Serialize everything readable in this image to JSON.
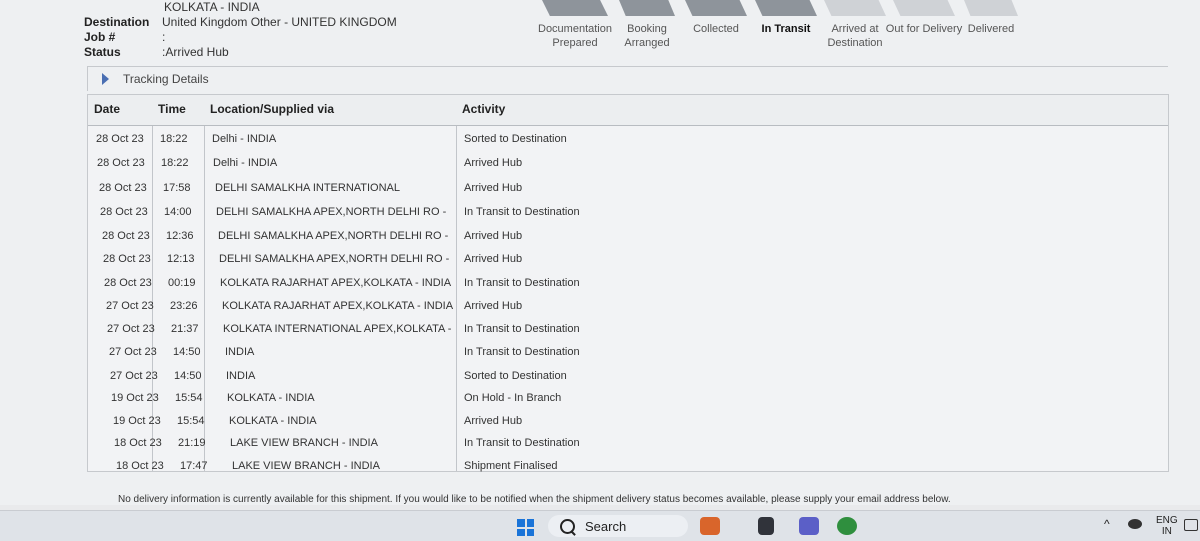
{
  "header": {
    "origin_value": "KOLKATA - INDIA",
    "destination_label": "Destination",
    "destination_value": "United Kingdom Other - UNITED KINGDOM",
    "job_label": "Job #",
    "job_value": ":",
    "status_label": "Status",
    "status_value": ":Arrived Hub"
  },
  "steps": [
    {
      "label": "Documentation Prepared",
      "state": "done"
    },
    {
      "label": "Booking Arranged",
      "state": "done"
    },
    {
      "label": "Collected",
      "state": "done"
    },
    {
      "label": "In Transit",
      "state": "current"
    },
    {
      "label": "Arrived at Destination",
      "state": "future"
    },
    {
      "label": "Out for Delivery",
      "state": "future"
    },
    {
      "label": "Delivered",
      "state": "future"
    }
  ],
  "tracking": {
    "section_title": "Tracking Details",
    "columns": {
      "date": "Date",
      "time": "Time",
      "location": "Location/Supplied via",
      "activity": "Activity"
    },
    "rows": [
      {
        "date": "28 Oct 23",
        "time": "18:22",
        "location": "Delhi - INDIA",
        "activity": "Sorted to Destination"
      },
      {
        "date": "28 Oct 23",
        "time": "18:22",
        "location": "Delhi - INDIA",
        "activity": "Arrived Hub"
      },
      {
        "date": "28 Oct 23",
        "time": "17:58",
        "location": "DELHI SAMALKHA INTERNATIONAL",
        "activity": "Arrived Hub"
      },
      {
        "date": "28 Oct 23",
        "time": "14:00",
        "location": "DELHI SAMALKHA APEX,NORTH DELHI RO -",
        "activity": "In Transit to Destination"
      },
      {
        "date": "28 Oct 23",
        "time": "12:36",
        "location": "DELHI SAMALKHA APEX,NORTH DELHI RO -",
        "activity": "Arrived Hub"
      },
      {
        "date": "28 Oct 23",
        "time": "12:13",
        "location": "DELHI SAMALKHA APEX,NORTH DELHI RO -",
        "activity": "Arrived Hub"
      },
      {
        "date": "28 Oct 23",
        "time": "00:19",
        "location": "KOLKATA RAJARHAT APEX,KOLKATA - INDIA",
        "activity": "In Transit to Destination"
      },
      {
        "date": "27 Oct 23",
        "time": "23:26",
        "location": "KOLKATA RAJARHAT APEX,KOLKATA - INDIA",
        "activity": "Arrived Hub"
      },
      {
        "date": "27 Oct 23",
        "time": "21:37",
        "location": "KOLKATA INTERNATIONAL APEX,KOLKATA -",
        "activity": "In Transit to Destination"
      },
      {
        "date": "27 Oct 23",
        "time": "14:50",
        "location": "INDIA",
        "activity": "In Transit to Destination"
      },
      {
        "date": "27 Oct 23",
        "time": "14:50",
        "location": "INDIA",
        "activity": "Sorted to Destination"
      },
      {
        "date": "19 Oct 23",
        "time": "15:54",
        "location": "KOLKATA - INDIA",
        "activity": "On Hold - In Branch"
      },
      {
        "date": "19 Oct 23",
        "time": "15:54",
        "location": "KOLKATA - INDIA",
        "activity": "Arrived Hub"
      },
      {
        "date": "18 Oct 23",
        "time": "21:19",
        "location": "LAKE VIEW BRANCH - INDIA",
        "activity": "In Transit to Destination"
      },
      {
        "date": "18 Oct 23",
        "time": "17:47",
        "location": "LAKE VIEW BRANCH - INDIA",
        "activity": "Shipment Finalised"
      }
    ]
  },
  "footer_note": "No delivery information is currently available for this shipment. If you would like to be notified when the shipment delivery status becomes available, please supply your email address below.",
  "taskbar": {
    "search_label": "Search",
    "lang_top": "ENG",
    "lang_bottom": "IN"
  }
}
